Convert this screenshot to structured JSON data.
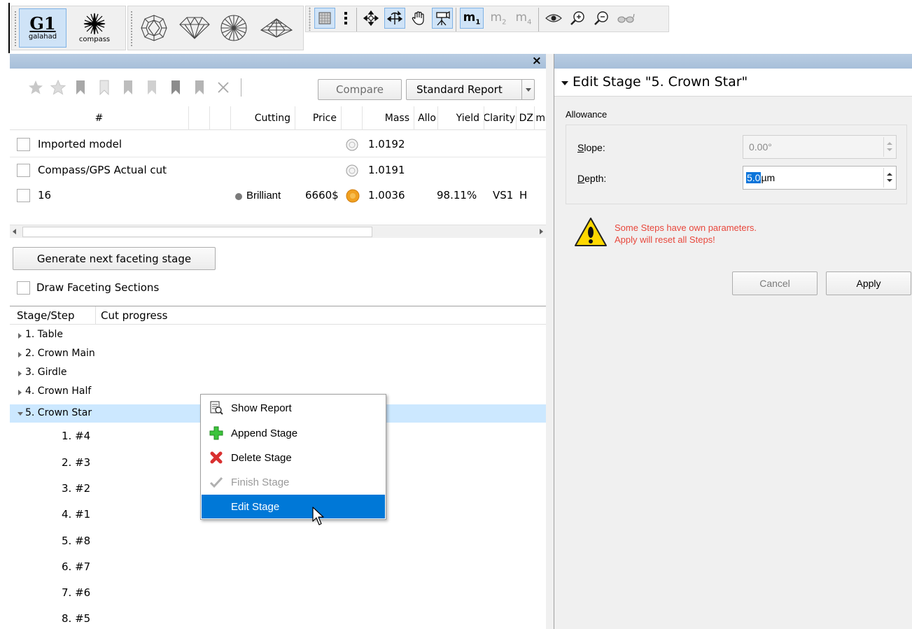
{
  "toolbar": {
    "galahad_logo_text": "G1",
    "galahad_label": "galahad",
    "compass_label": "compass",
    "m1_label": "m",
    "m1_sub": "1",
    "m2_label": "m",
    "m2_sub": "2",
    "m4_label": "m",
    "m4_sub": "4"
  },
  "left_panel": {
    "close_glyph": "×",
    "compare_label": "Compare",
    "report_label": "Standard Report",
    "columns": [
      "#",
      "Cutting",
      "Price",
      "Mass",
      "Allo",
      "Yield",
      "Clarity",
      "DZ",
      "m"
    ],
    "rows": [
      {
        "name": "Imported model",
        "cutting": "",
        "price": "",
        "mass": "1.0192",
        "yield": "",
        "clarity": "",
        "color": ""
      },
      {
        "name": "Compass/GPS Actual cut",
        "cutting": "",
        "price": "",
        "mass": "1.0191",
        "yield": "",
        "clarity": "",
        "color": ""
      },
      {
        "name": "16",
        "cutting": "Brilliant",
        "price": "6660$",
        "mass": "1.0036",
        "yield": "98.11%",
        "clarity": "VS1",
        "color": "H"
      }
    ],
    "generate_label": "Generate next faceting stage",
    "draw_sections_label": "Draw Faceting Sections",
    "tree_headers": [
      "Stage/Step",
      "Cut progress"
    ],
    "stages": [
      "1. Table",
      "2. Crown Main",
      "3. Girdle",
      "4. Crown Half",
      "5. Crown Star"
    ],
    "steps": [
      "1. #4",
      "2. #3",
      "3. #2",
      "4. #1",
      "5. #8",
      "6. #7",
      "7. #6",
      "8. #5"
    ]
  },
  "context_menu": {
    "items": [
      {
        "label": "Show Report",
        "icon": "report-icon",
        "enabled": true
      },
      {
        "label": "Append Stage",
        "icon": "green-plus-icon",
        "enabled": true
      },
      {
        "label": "Delete Stage",
        "icon": "red-x-icon",
        "enabled": true
      },
      {
        "label": "Finish Stage",
        "icon": "checkmark-icon",
        "enabled": false
      },
      {
        "label": "Edit Stage",
        "icon": "",
        "enabled": true,
        "highlighted": true
      }
    ]
  },
  "right_panel": {
    "title": "Edit Stage \"5. Crown Star\"",
    "group_label": "Allowance",
    "slope_label": "Slope:",
    "slope_value": "0.00°",
    "depth_label": "Depth:",
    "depth_value_selected": "5.0",
    "depth_unit": "µm",
    "warning_line1": "Some Steps have own parameters.",
    "warning_line2": "Apply will reset all Steps!",
    "cancel_label": "Cancel",
    "apply_label": "Apply"
  },
  "colors": {
    "selection_blue": "#0a74da",
    "menu_highlight": "#0078d7",
    "warning_red": "#e8473c",
    "row_highlight": "#cce8ff",
    "orange_dot": "#f0a020"
  }
}
